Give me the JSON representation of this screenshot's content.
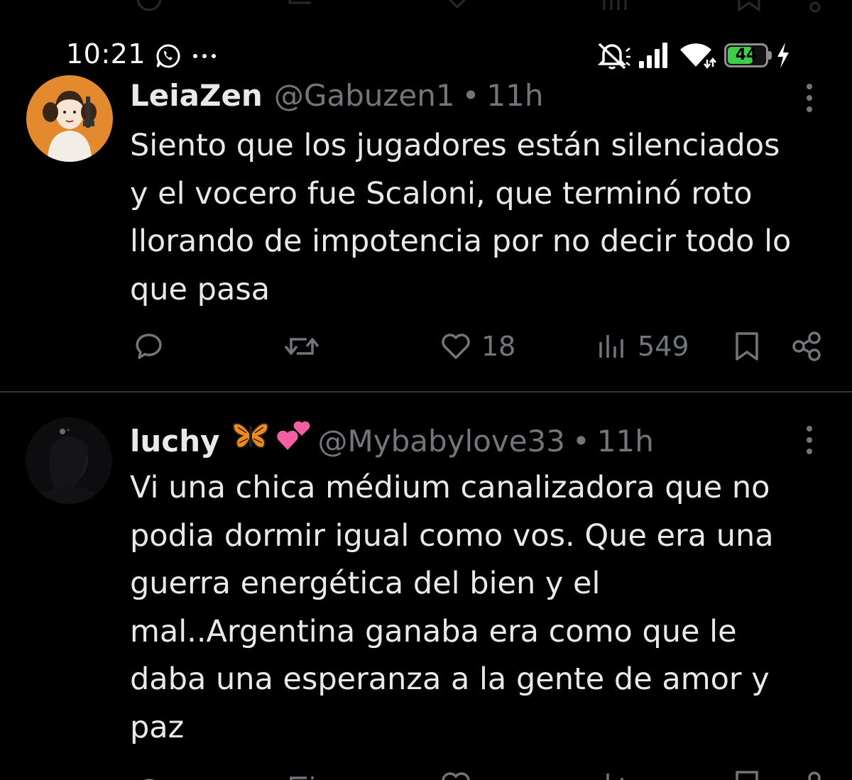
{
  "status_bar": {
    "time": "10:21",
    "battery_level": "44",
    "battery_percent": 44,
    "icons": [
      "whatsapp-icon",
      "more-dots-icon",
      "mute-icon",
      "cell-signal-icon",
      "wifi-icon",
      "battery-icon",
      "charging-icon"
    ]
  },
  "tweets": [
    {
      "display_name": "LeiaZen",
      "handle": "@Gabuzen1",
      "separator": "•",
      "time": "11h",
      "text_lines": [
        "Siento que los jugadores están silenciados",
        "y el vocero fue Scaloni, que terminó roto",
        "llorando de impotencia por no decir todo lo",
        "que pasa"
      ],
      "likes": "18",
      "views": "549"
    },
    {
      "display_name": "luchy",
      "name_emojis": [
        "butterfly",
        "two-hearts"
      ],
      "handle": "@Mybabylove33",
      "separator": "•",
      "time": "11h",
      "text_lines": [
        "Vi una chica médium canalizadora que no",
        "podia dormir igual como vos. Que era una",
        "guerra energética del bien y el",
        "mal..Argentina ganaba era como que le",
        "daba una esperanza a la gente de amor y",
        "paz"
      ]
    }
  ],
  "colors": {
    "background": "#000000",
    "text": "#e7e9ea",
    "secondary": "#71767b",
    "divider": "#2f3336",
    "battery": "#3ecf4a"
  }
}
